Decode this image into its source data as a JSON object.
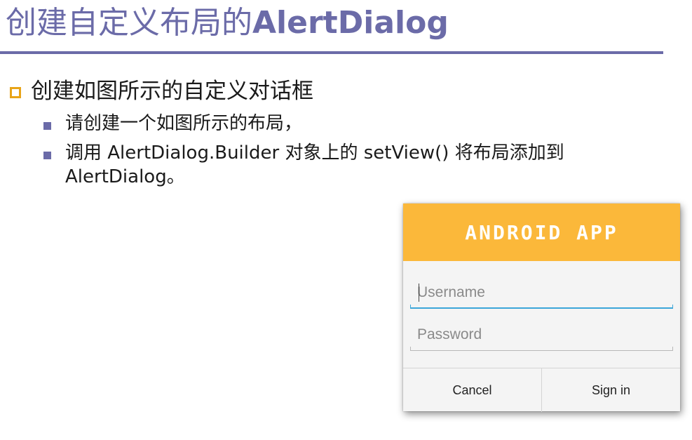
{
  "slide": {
    "title_cn": "创建自定义布局的",
    "title_en": "AlertDialog",
    "level1": "创建如图所示的自定义对话框",
    "level2": [
      {
        "text": "请创建一个如图所示的布局，"
      },
      {
        "text": "调用 AlertDialog.Builder 对象上的 setView() 将布局添加到",
        "line2": "AlertDialog。"
      }
    ]
  },
  "dialog": {
    "app_title": "ANDROID APP",
    "username_placeholder": "Username",
    "password_placeholder": "Password",
    "cancel_label": "Cancel",
    "signin_label": "Sign in"
  },
  "colors": {
    "title": "#6b6ba8",
    "bullet_l1": "#e8a418",
    "bullet_l2": "#6b6ba8",
    "dialog_header": "#fbb83a",
    "focus_underline": "#3ca6d9"
  }
}
